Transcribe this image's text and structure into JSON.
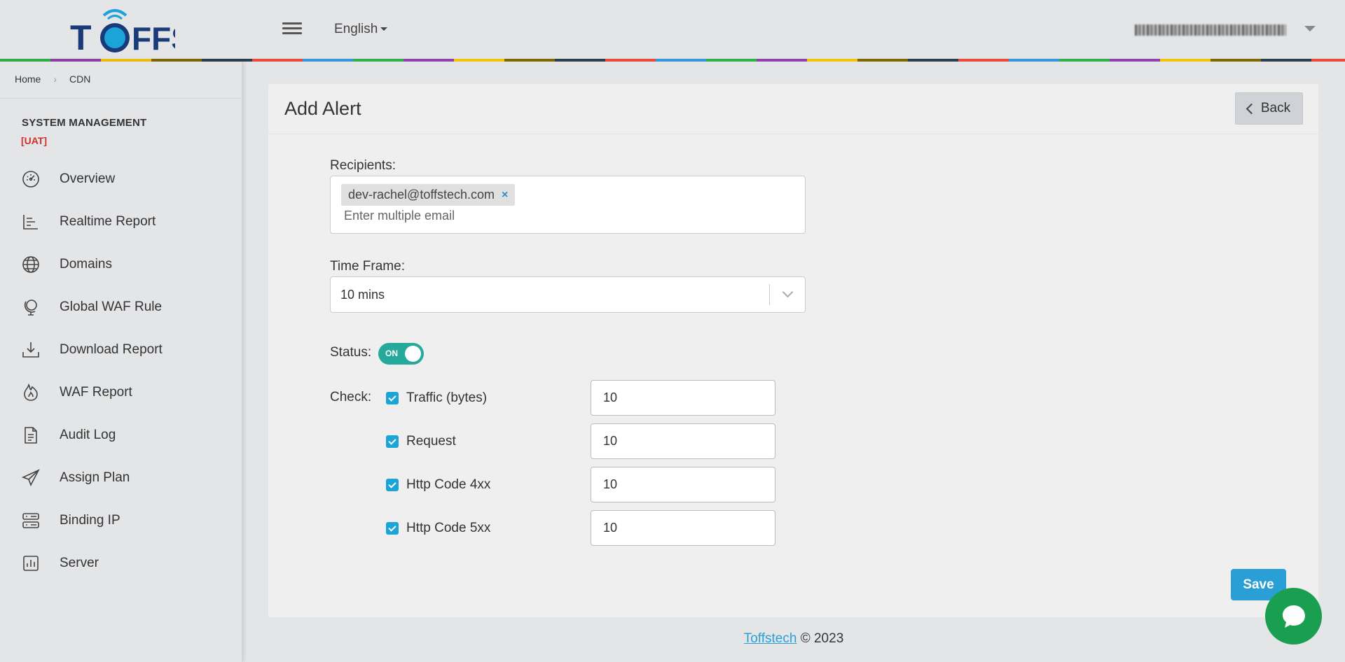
{
  "header": {
    "logo_text": "TOFFS",
    "language": "English",
    "user_email": "dev-rachel@toffstech.com"
  },
  "breadcrumb": {
    "home": "Home",
    "current": "CDN"
  },
  "sidebar": {
    "section_title": "SYSTEM MANAGEMENT",
    "env_tag": "[UAT]",
    "items": [
      {
        "label": "Overview",
        "icon": "dashboard-icon"
      },
      {
        "label": "Realtime Report",
        "icon": "bar-chart-icon"
      },
      {
        "label": "Domains",
        "icon": "globe-icon"
      },
      {
        "label": "Global WAF Rule",
        "icon": "globe-stand-icon"
      },
      {
        "label": "Download Report",
        "icon": "download-icon"
      },
      {
        "label": "WAF Report",
        "icon": "flame-icon"
      },
      {
        "label": "Audit Log",
        "icon": "document-icon"
      },
      {
        "label": "Assign Plan",
        "icon": "paper-plane-icon"
      },
      {
        "label": "Binding IP",
        "icon": "server-icon"
      },
      {
        "label": "Server",
        "icon": "chart-box-icon"
      }
    ]
  },
  "page": {
    "title": "Add Alert",
    "back_label": "Back",
    "recipients_label": "Recipients:",
    "recipient_tags": [
      "dev-rachel@toffstech.com"
    ],
    "recipient_remove": "×",
    "recipients_placeholder": "Enter multiple email",
    "timeframe_label": "Time Frame:",
    "timeframe_value": "10 mins",
    "status_label": "Status:",
    "status_toggle": "ON",
    "check_label": "Check:",
    "checks": [
      {
        "label": "Traffic (bytes)",
        "value": "10",
        "checked": true
      },
      {
        "label": "Request",
        "value": "10",
        "checked": true
      },
      {
        "label": "Http Code 4xx",
        "value": "10",
        "checked": true
      },
      {
        "label": "Http Code 5xx",
        "value": "10",
        "checked": true
      }
    ],
    "save_label": "Save"
  },
  "footer": {
    "link": "Toffstech",
    "text": " © 2023"
  },
  "colors": {
    "accent": "#2a9fd6",
    "toggle_on": "#25a99b",
    "uat": "#d0302a",
    "chat": "#1a9e4f"
  }
}
